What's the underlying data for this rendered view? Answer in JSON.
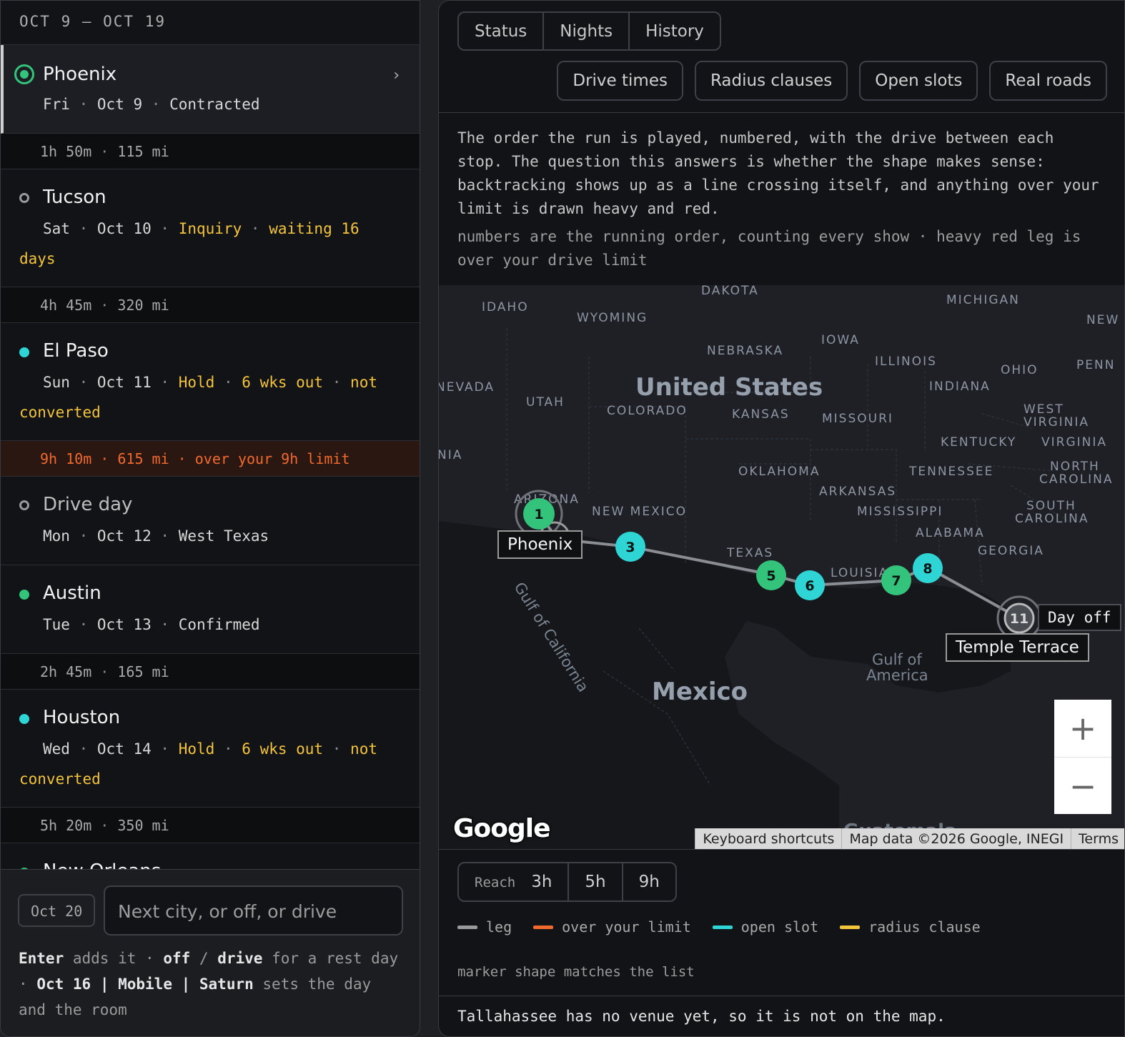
{
  "sidebar": {
    "date_range": "OCT 9 — OCT 19",
    "stops": [
      {
        "name": "Phoenix",
        "day": "Fri",
        "date": "Oct 9",
        "status": "Contracted"
      },
      {
        "name": "Tucson",
        "day": "Sat",
        "date": "Oct 10",
        "status": "Inquiry",
        "note": "waiting 16 days"
      },
      {
        "name": "El Paso",
        "day": "Sun",
        "date": "Oct 11",
        "status": "Hold",
        "note": "6 wks out",
        "note2": "not converted"
      },
      {
        "name": "Drive day",
        "day": "Mon",
        "date": "Oct 12",
        "status": "West Texas"
      },
      {
        "name": "Austin",
        "day": "Tue",
        "date": "Oct 13",
        "status": "Confirmed"
      },
      {
        "name": "Houston",
        "day": "Wed",
        "date": "Oct 14",
        "status": "Hold",
        "note": "6 wks out",
        "note2": "not converted"
      },
      {
        "name": "New Orleans"
      }
    ],
    "legs": [
      {
        "time": "1h 50m",
        "dist": "115 mi"
      },
      {
        "time": "4h 45m",
        "dist": "320 mi"
      },
      {
        "time": "9h 10m",
        "dist": "615 mi",
        "warning": "over your 9h limit"
      },
      {
        "time": "2h 45m",
        "dist": "165 mi"
      },
      {
        "time": "5h 20m",
        "dist": "350 mi"
      }
    ]
  },
  "composer": {
    "date": "Oct 20",
    "placeholder": "Next city, or off, or drive",
    "hint": {
      "k1": "Enter",
      "t1": "adds it ·",
      "k2": "off",
      "t2": "/",
      "k3": "drive",
      "t3": "for a rest day",
      "t4": "·",
      "k4": "Oct 16 | Mobile | Saturn",
      "t5": "sets the day and the room"
    }
  },
  "tabs": [
    "Status",
    "Nights",
    "History"
  ],
  "toggles": [
    "Drive times",
    "Radius clauses",
    "Open slots",
    "Real roads"
  ],
  "description": "The order the run is played, numbered, with the drive between each stop. The question this answers is whether the shape makes sense: backtracking shows up as a line crossing itself, and anything over your limit is drawn heavy and red.",
  "description_note": "numbers are the running order, counting every show · heavy red leg is over your drive limit",
  "map": {
    "country_labels": [
      "United States",
      "Mexico"
    ],
    "water_labels": [
      "Gulf of California",
      "Gulf of",
      "America"
    ],
    "state_labels": [
      "IDAHO",
      "WYOMING",
      "DAKOTA",
      "MICHIGAN",
      "NEW",
      "IOWA",
      "NEBRASKA",
      "ILLINOIS",
      "OHIO",
      "PENN",
      "NEVADA",
      "UTAH",
      "COLORADO",
      "KANSAS",
      "INDIANA",
      "MISSOURI",
      "WEST",
      "VIRGINIA",
      "KENTUCKY",
      "VIRGINIA",
      "NIA",
      "OKLAHOMA",
      "TENNESSEE",
      "NORTH",
      "CAROLINA",
      "ARKANSAS",
      "ARIZONA",
      "NEW MEXICO",
      "MISSISSIPPI",
      "SOUTH",
      "CAROLINA",
      "ALABAMA",
      "TEXAS",
      "GEORGIA",
      "LOUISIA",
      "Guatemala"
    ],
    "markers": [
      {
        "num": "1",
        "color": "#34c37a"
      },
      {
        "num": "3",
        "color": "#2fd5d5"
      },
      {
        "num": "5",
        "color": "#34c37a"
      },
      {
        "num": "6",
        "color": "#2fd5d5"
      },
      {
        "num": "7",
        "color": "#34c37a"
      },
      {
        "num": "8",
        "color": "#2fd5d5"
      },
      {
        "num": "11",
        "color": "#4a4d52"
      }
    ],
    "labels": {
      "phoenix": "Phoenix",
      "day_off": "Day off",
      "temple_terrace": "Temple Terrace"
    },
    "zoom_in": "+",
    "zoom_out": "−",
    "google": "Google",
    "attribution": [
      "Keyboard shortcuts",
      "Map data ©2026 Google, INEGI",
      "Terms"
    ]
  },
  "reach": {
    "label": "Reach",
    "options": [
      "3h",
      "5h",
      "9h"
    ]
  },
  "legend": [
    {
      "label": "leg",
      "color": "#9a9a9a"
    },
    {
      "label": "over your limit",
      "color": "#f06a2e"
    },
    {
      "label": "open slot",
      "color": "#2fd5d5"
    },
    {
      "label": "radius clause",
      "color": "#f3c33b"
    }
  ],
  "marker_note": "marker shape matches the list",
  "footnote": "Tallahassee has no venue yet, so it is not on the map."
}
